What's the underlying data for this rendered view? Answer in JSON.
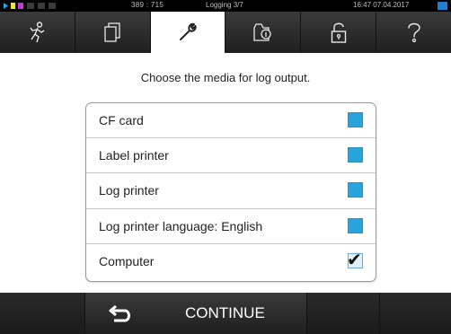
{
  "status_bar": {
    "coordinates": "389 : 715",
    "title": "Logging 3/7",
    "datetime": "16:47  07.04.2017",
    "indicator_colors": [
      "#2aa7e0",
      "#e9e93a",
      "#c03bd0",
      "#3a3a3a",
      "#3a3a3a",
      "#3a3a3a"
    ],
    "usb_color": "#1f7fd0"
  },
  "tabs": [
    {
      "icon": "running-man-icon",
      "active": false
    },
    {
      "icon": "documents-icon",
      "active": false
    },
    {
      "icon": "wrench-icon",
      "active": true
    },
    {
      "icon": "document-info-icon",
      "active": false
    },
    {
      "icon": "padlock-icon",
      "active": false
    },
    {
      "icon": "question-mark-icon",
      "active": false
    }
  ],
  "prompt": "Choose the media for log output.",
  "options": [
    {
      "label": "CF card",
      "checked": false
    },
    {
      "label": "Label printer",
      "checked": false
    },
    {
      "label": "Log printer",
      "checked": false
    },
    {
      "label": "Log printer language: English",
      "checked": false
    },
    {
      "label": "Computer",
      "checked": true
    }
  ],
  "bottom_bar": {
    "back_icon": "back-arrow-icon",
    "continue_label": "CONTINUE"
  },
  "colors": {
    "checkbox_fill": "#29a3db",
    "bar_background": "#2d2d2d"
  }
}
